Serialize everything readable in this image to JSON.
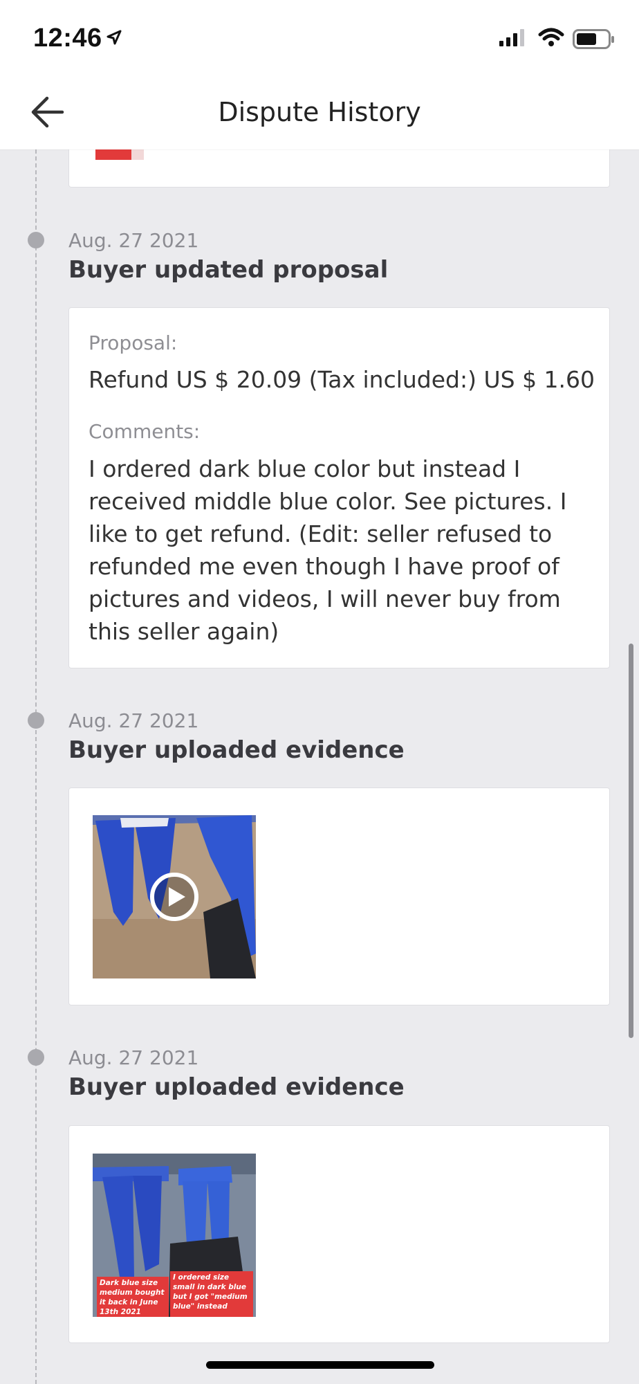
{
  "status_bar": {
    "time": "12:46"
  },
  "header": {
    "title": "Dispute History"
  },
  "events": [
    {
      "date": "Aug. 27 2021",
      "title": "Buyer updated proposal",
      "proposal_label": "Proposal:",
      "proposal_value": "Refund US $ 20.09 (Tax included:) US $ 1.60",
      "comments_label": "Comments:",
      "comments_value": "I ordered dark blue color but instead I received middle blue color. See pictures. I like to get refund. (Edit: seller refused to refunded me even though I have proof of pictures and videos, I will never buy from this seller again)"
    },
    {
      "date": "Aug. 27 2021",
      "title": "Buyer uploaded evidence",
      "media_type": "video"
    },
    {
      "date": "Aug. 27 2021",
      "title": "Buyer uploaded evidence",
      "media_type": "image",
      "image_captions": [
        "Dark blue size medium bought it back in June 13th 2021",
        "I ordered size small in dark blue but I got \"medium blue\" instead"
      ]
    }
  ],
  "colors": {
    "background": "#ebebee",
    "card": "#ffffff",
    "timeline_dot": "#a9a9ae",
    "caption_red": "#e23a3a"
  },
  "icons": [
    "back-arrow-icon",
    "location-arrow-icon",
    "signal-icon",
    "wifi-icon",
    "battery-icon",
    "play-icon"
  ]
}
